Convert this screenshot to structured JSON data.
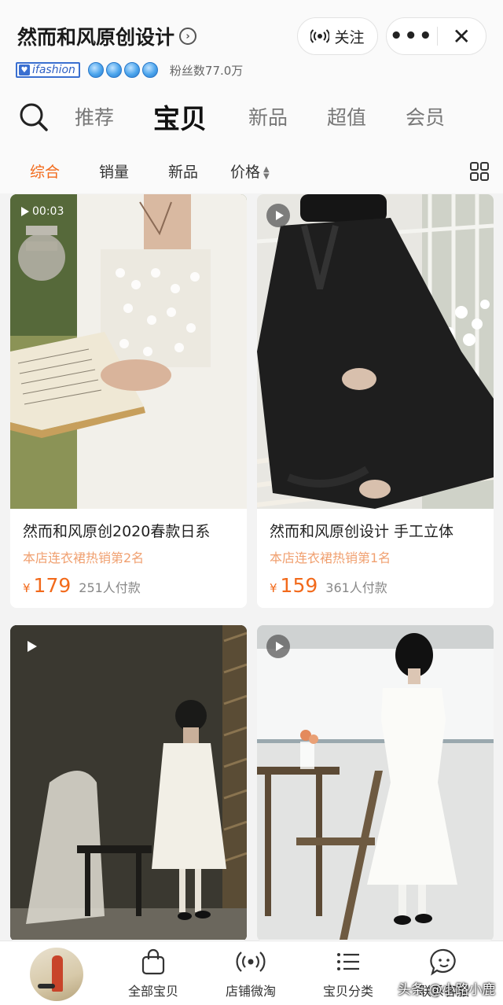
{
  "shop": {
    "name": "然而和风原创设计",
    "follow_label": "关注",
    "more_label": "•••",
    "close_label": "✕",
    "brand_badge": "ifashion",
    "fans": "粉丝数77.0万"
  },
  "tabs": [
    {
      "label": "推荐"
    },
    {
      "label": "宝贝"
    },
    {
      "label": "新品"
    },
    {
      "label": "超值"
    },
    {
      "label": "会员"
    }
  ],
  "sort": [
    {
      "label": "综合"
    },
    {
      "label": "销量"
    },
    {
      "label": "新品"
    },
    {
      "label": "价格"
    }
  ],
  "products": [
    {
      "title": "然而和风原创2020春款日系",
      "rank": "本店连衣裙热销第2名",
      "currency": "¥",
      "price": "179",
      "sold": "251人付款",
      "video_time": "00:03"
    },
    {
      "title": "然而和风原创设计 手工立体",
      "rank": "本店连衣裙热销第1名",
      "currency": "¥",
      "price": "159",
      "sold": "361人付款"
    },
    {},
    {}
  ],
  "bottom_nav": [
    {
      "label": "全部宝贝",
      "icon": "shopping-bag-icon"
    },
    {
      "label": "店铺微淘",
      "icon": "broadcast-icon"
    },
    {
      "label": "宝贝分类",
      "icon": "list-icon"
    },
    {
      "label": "联系客服",
      "icon": "chat-face-icon"
    }
  ],
  "watermark": "头条 @小路小鹿",
  "colors": {
    "accent": "#f26a1b",
    "rank": "#f0a070",
    "badge_blue": "#3a6fd0"
  }
}
